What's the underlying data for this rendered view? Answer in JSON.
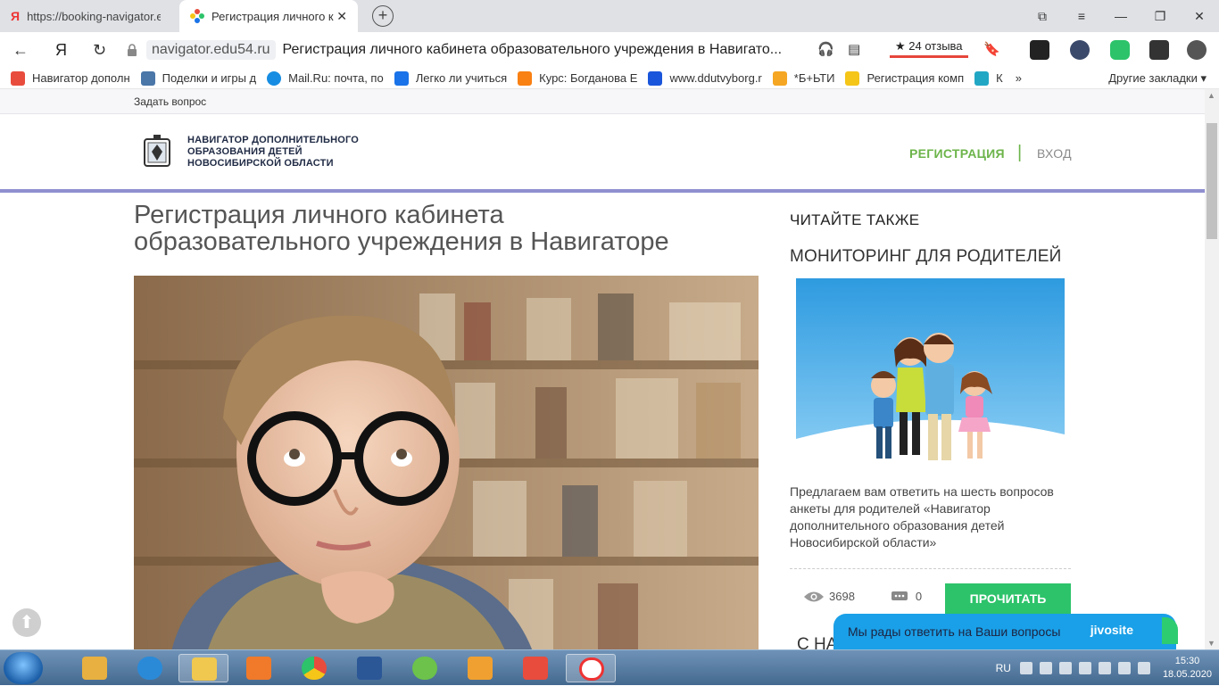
{
  "browser": {
    "tabs": [
      {
        "label": "https://booking-navigator.e",
        "active": false
      },
      {
        "label": "Регистрация личного к",
        "active": true
      }
    ],
    "new_tab_symbol": "+",
    "address": {
      "domain": "navigator.edu54.ru",
      "page_title": "Регистрация личного кабинета образовательного учреждения в Навигато..."
    },
    "reviews_label": "★ 24 отзыва",
    "bookmarks": [
      {
        "label": "Навигатор дополн",
        "icon": "navigator-icon",
        "color": "#e84c3d"
      },
      {
        "label": "Поделки и игры д",
        "icon": "vk-icon",
        "color": "#4a76a8"
      },
      {
        "label": "Mail.Ru: почта, по",
        "icon": "mailru-icon",
        "color": "#168de2"
      },
      {
        "label": "Легко ли учиться",
        "icon": "n-icon",
        "color": "#1a73e8"
      },
      {
        "label": "Курс: Богданова Е",
        "icon": "moodle-icon",
        "color": "#f98012"
      },
      {
        "label": "www.ddutvyborg.r",
        "icon": "search-icon",
        "color": "#1a56db"
      },
      {
        "label": "*Б+ЬТИ",
        "icon": "owl-icon",
        "color": "#f5a623"
      },
      {
        "label": "Регистрация комп",
        "icon": "play-icon",
        "color": "#f5c518"
      },
      {
        "label": "К",
        "icon": "k-icon",
        "color": "#21a7c4"
      }
    ],
    "other_bookmarks": "Другие закладки"
  },
  "site": {
    "ask_question": "Задать вопрос",
    "logo_lines": [
      "НАВИГАТОР ДОПОЛНИТЕЛЬНОГО",
      "ОБРАЗОВАНИЯ ДЕТЕЙ",
      "НОВОСИБИРСКОЙ ОБЛАСТИ"
    ],
    "nav": {
      "register": "РЕГИСТРАЦИЯ",
      "separator": "|",
      "login": "ВХОД"
    },
    "colors": {
      "accent_green": "#6cb44a",
      "header_border": "#8f8fcf",
      "read_button": "#2dc36a",
      "chat": "#1aa0e8"
    }
  },
  "article": {
    "title_line1": "Регистрация личного кабинета",
    "title_line2": "образовательного учреждения в Навигаторе"
  },
  "sidebar": {
    "heading": "ЧИТАЙТЕ ТАКЖЕ",
    "card_title": "МОНИТОРИНГ ДЛЯ РОДИТЕЛЕЙ",
    "description": "Предлагаем вам ответить на шесть вопросов анкеты для родителей «Навигатор дополнительного образования детей Новосибирской области»",
    "views": "3698",
    "comments": "0",
    "read_button": "ПРОЧИТАТЬ",
    "next_heading": "С НА"
  },
  "chat": {
    "text": "Мы рады ответить на Ваши вопросы",
    "brand": "jivosite"
  },
  "taskbar": {
    "language": "RU",
    "time": "15:30",
    "date": "18.05.2020"
  }
}
